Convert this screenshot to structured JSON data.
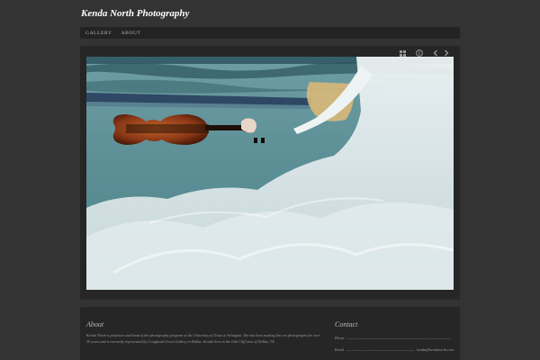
{
  "site": {
    "title": "Kenda North Photography"
  },
  "nav": {
    "items": [
      {
        "label": "GALLERY"
      },
      {
        "label": "ABOUT"
      }
    ]
  },
  "gallery": {
    "toolbar": [
      {
        "icon": "grid-icon"
      },
      {
        "icon": "info-icon"
      },
      {
        "icon": "chevron-left-icon"
      },
      {
        "icon": "chevron-right-icon"
      }
    ]
  },
  "about": {
    "heading": "About",
    "text": "Kenda North is professor and head of the photography program at the University of Texas at Arlington. She has been making fine art photographs for over 30 years and is currently represented by Craighead Green Gallery in Dallas. Kenda lives in the Oak Cliff area of Dallas, TX."
  },
  "contact": {
    "heading": "Contact",
    "phone_label": "Phone",
    "phone_value": "",
    "email_label": "Email",
    "email_value": "kenda@kendanorth.com"
  },
  "colors": {
    "background": "#333333",
    "panel": "#262626",
    "nav": "#232323",
    "water": "#5f8f96"
  }
}
